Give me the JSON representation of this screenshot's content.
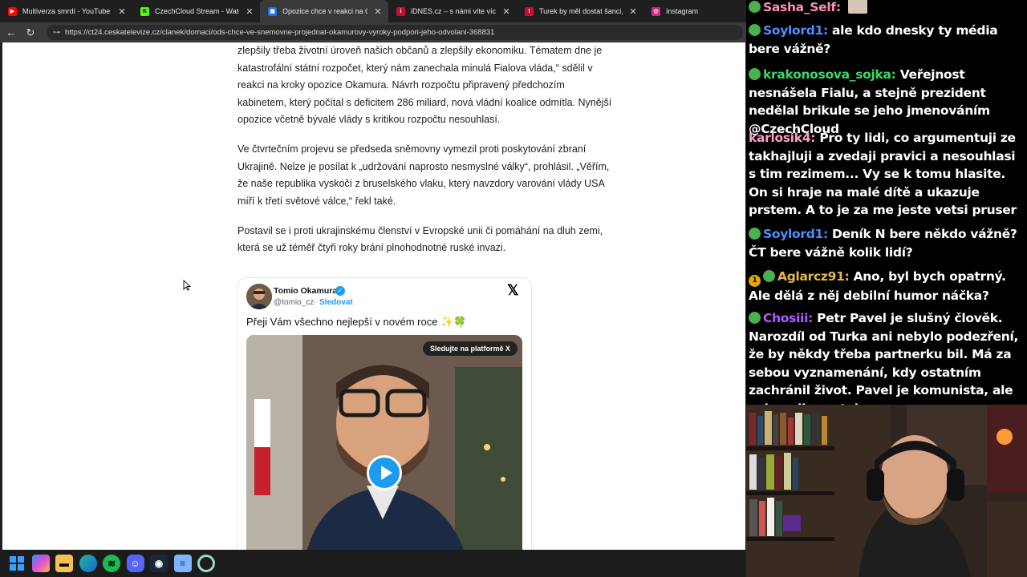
{
  "tabs": [
    {
      "title": "Multiverza smrdí - YouTube",
      "favicon_color": "#ff0000",
      "favicon": "▶"
    },
    {
      "title": "CzechCloud Stream - Watch Live o",
      "favicon_color": "#53fc18",
      "favicon": "K"
    },
    {
      "title": "Opozice chce v reakci na Okamur",
      "favicon_color": "#1a73e8",
      "favicon": "▣",
      "active": true
    },
    {
      "title": "iDNES.cz – s námi víte víc",
      "favicon_color": "#c8102e",
      "favicon": "i"
    },
    {
      "title": "Turek by měl dostat šanci, říká Bab",
      "favicon_color": "#c8102e",
      "favicon": "!"
    },
    {
      "title": "Instagram",
      "favicon_color": "#d62976",
      "favicon": "◎"
    }
  ],
  "url": "https://ct24.ceskatelevize.cz/clanek/domaci/ods-chce-ve-snemovne-projednat-okamurovy-vyroky-podpori-jeho-odvolani-368831",
  "article": {
    "paragraphs": [
      "zlepšily třeba životní úroveň našich občanů a zlepšily ekonomiku. Tématem dne je katastrofální státní rozpočet, který nám zanechala minulá Fialova vláda,“ sdělil v reakci na kroky opozice Okamura. Návrh rozpočtu připravený předchozím kabinetem, který počítal s deficitem 286 miliard, nová vládní koalice odmítla. Nynější opozice včetně bývalé vlády s kritikou rozpočtu nesouhlasí.",
      "Ve čtvrtečním projevu se předseda sněmovny vymezil proti poskytování zbraní Ukrajině. Nelze je posílat k „udržování naprosto nesmyslné války“, prohlásil. „Věřím, že naše republika vyskočí z bruselského vlaku, který navzdory varování vlády USA míří k třetí světové válce,“ řekl také.",
      "Postavil se i proti ukrajinskému členství v Evropské unii či pomáhání na dluh zemi, která se už téměř čtyři roky brání plnohodnotné ruské invazi."
    ]
  },
  "tweet": {
    "name": "Tomio Okamura",
    "handle": "@tomio_cz",
    "separator": "·",
    "follow": "Sledovat",
    "text": "Přeji Vám všechno nejlepší v novém roce ✨🍀",
    "platform_label": "Sledujte na platformě X"
  },
  "chat": [
    {
      "user": "Sasha_Self:",
      "color": "#ff8fb8",
      "badges": [
        "green"
      ],
      "text": ""
    },
    {
      "user": "Soylord1:",
      "color": "#4d8fff",
      "badges": [
        "green"
      ],
      "text": "ale kdo dnesky ty média bere vážně?"
    },
    {
      "user": "krakonosova_sojka:",
      "color": "#3cd66b",
      "badges": [
        "green"
      ],
      "text": "Veřejnost nesnášela Fialu, a stejně prezident nedělal brikule se jeho jmenováním @CzechCloud"
    },
    {
      "user": "karlosik4:",
      "color": "#ff9ec7",
      "badges": [],
      "text": "Pro ty lidi, co argumentuji ze takhajluji a zvedaji pravici a nesouhlasi s tim rezimem... Vy se k tomu hlasite. On si hraje na malé dítě a ukazuje prstem. A to je za me jeste vetsi pruser"
    },
    {
      "user": "Soylord1:",
      "color": "#4d8fff",
      "badges": [
        "green"
      ],
      "text": "Deník N bere někdo vážně? ČT bere vážně kolik lidí?"
    },
    {
      "user": "Aglarcz91:",
      "color": "#e8b64a",
      "badges": [
        "gold",
        "green"
      ],
      "text": "Ano, byl bych opatrný. Ale dělá z něj debilní humor náčka?"
    },
    {
      "user": "Chosiii:",
      "color": "#b05cff",
      "badges": [
        "green"
      ],
      "text": "Petr Pavel je slušný člověk. Narozdíl od Turka ani nebylo podezření, že by někdy třeba partnerku bil. Má za sebou vyznamenání, kdy ostatním zachránil život. Pavel je komunista, ale vykoupil se z toho."
    }
  ],
  "taskbar": [
    "windows-icon",
    "copilot-icon",
    "file-explorer-icon",
    "edge-icon",
    "spotify-icon",
    "discord-icon",
    "steam-icon",
    "notepad-icon",
    "obs-icon"
  ]
}
